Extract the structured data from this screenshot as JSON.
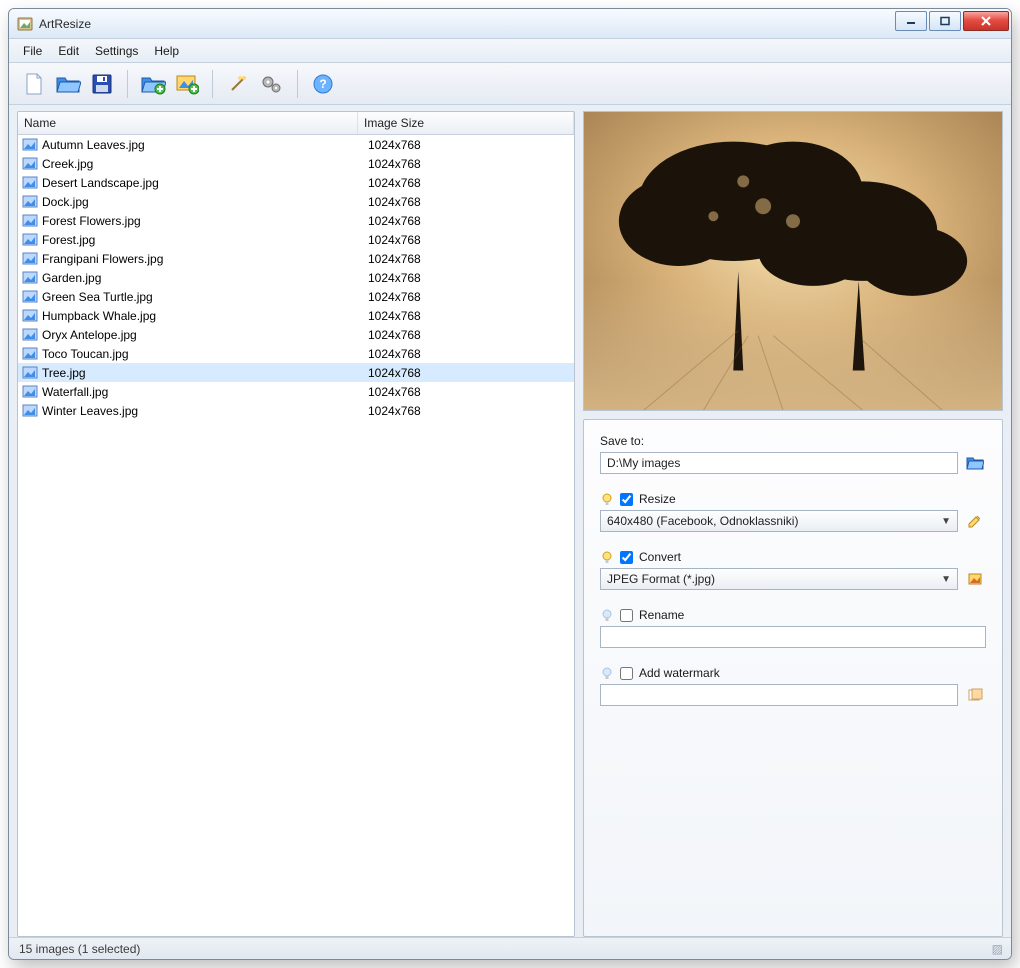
{
  "window": {
    "title": "ArtResize"
  },
  "menu": {
    "file": "File",
    "edit": "Edit",
    "settings": "Settings",
    "help": "Help"
  },
  "toolbar": {
    "new": "new-file",
    "open": "open-folder",
    "save": "save-disk",
    "add_folder": "add-folder",
    "add_image": "add-image",
    "wand": "magic-wand",
    "gears": "gears",
    "help": "help-bubble"
  },
  "list": {
    "cols": {
      "name": "Name",
      "size": "Image Size"
    },
    "items": [
      {
        "name": "Autumn Leaves.jpg",
        "size": "1024x768"
      },
      {
        "name": "Creek.jpg",
        "size": "1024x768"
      },
      {
        "name": "Desert Landscape.jpg",
        "size": "1024x768"
      },
      {
        "name": "Dock.jpg",
        "size": "1024x768"
      },
      {
        "name": "Forest Flowers.jpg",
        "size": "1024x768"
      },
      {
        "name": "Forest.jpg",
        "size": "1024x768"
      },
      {
        "name": "Frangipani Flowers.jpg",
        "size": "1024x768"
      },
      {
        "name": "Garden.jpg",
        "size": "1024x768"
      },
      {
        "name": "Green Sea Turtle.jpg",
        "size": "1024x768"
      },
      {
        "name": "Humpback Whale.jpg",
        "size": "1024x768"
      },
      {
        "name": "Oryx Antelope.jpg",
        "size": "1024x768"
      },
      {
        "name": "Toco Toucan.jpg",
        "size": "1024x768"
      },
      {
        "name": "Tree.jpg",
        "size": "1024x768"
      },
      {
        "name": "Waterfall.jpg",
        "size": "1024x768"
      },
      {
        "name": "Winter Leaves.jpg",
        "size": "1024x768"
      }
    ],
    "selected_index": 12
  },
  "options": {
    "save_to_label": "Save to:",
    "save_to_value": "D:\\My images",
    "resize_label": "Resize",
    "resize_checked": true,
    "resize_value": "640x480 (Facebook, Odnoklassniki)",
    "convert_label": "Convert",
    "convert_checked": true,
    "convert_value": "JPEG Format (*.jpg)",
    "rename_label": "Rename",
    "rename_checked": false,
    "rename_value": "",
    "watermark_label": "Add watermark",
    "watermark_checked": false,
    "watermark_value": ""
  },
  "status": {
    "text": "15 images (1 selected)"
  }
}
